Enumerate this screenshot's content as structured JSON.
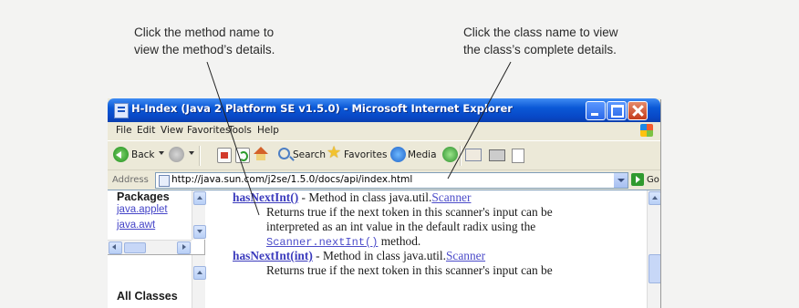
{
  "callouts": {
    "left": {
      "line1": "Click the method name to",
      "line2": "view the method’s details."
    },
    "right": {
      "line1": "Click the class name to view",
      "line2": "the class’s complete details."
    }
  },
  "window": {
    "title": "H-Index (Java 2 Platform SE v1.5.0) - Microsoft Internet Explorer",
    "menu": [
      "File",
      "Edit",
      "View",
      "Favorites",
      "Tools",
      "Help"
    ],
    "toolbar": {
      "back": "Back",
      "search": "Search",
      "favorites": "Favorites",
      "media": "Media"
    },
    "address": {
      "label": "Address",
      "value": "http://java.sun.com/j2se/1.5.0/docs/api/index.html",
      "go": "Go"
    }
  },
  "packages_frame": {
    "heading": "Packages",
    "links": [
      "java.applet",
      "java.awt"
    ]
  },
  "classes_frame": {
    "heading": "All Classes"
  },
  "index_entries": [
    {
      "name": "hasNextInt()",
      "kind": " - Method in class java.util.",
      "class": "Scanner",
      "desc_line1": "Returns true if the next token in this scanner's input can be",
      "desc_line2": "interpreted as an int value in the default radix using the",
      "desc_code": "Scanner.nextInt()",
      "desc_tail": " method."
    },
    {
      "name": "hasNextInt(int)",
      "kind": " - Method in class java.util.",
      "class": "Scanner",
      "desc_line1": "Returns true if the next token in this scanner's input can be"
    }
  ]
}
